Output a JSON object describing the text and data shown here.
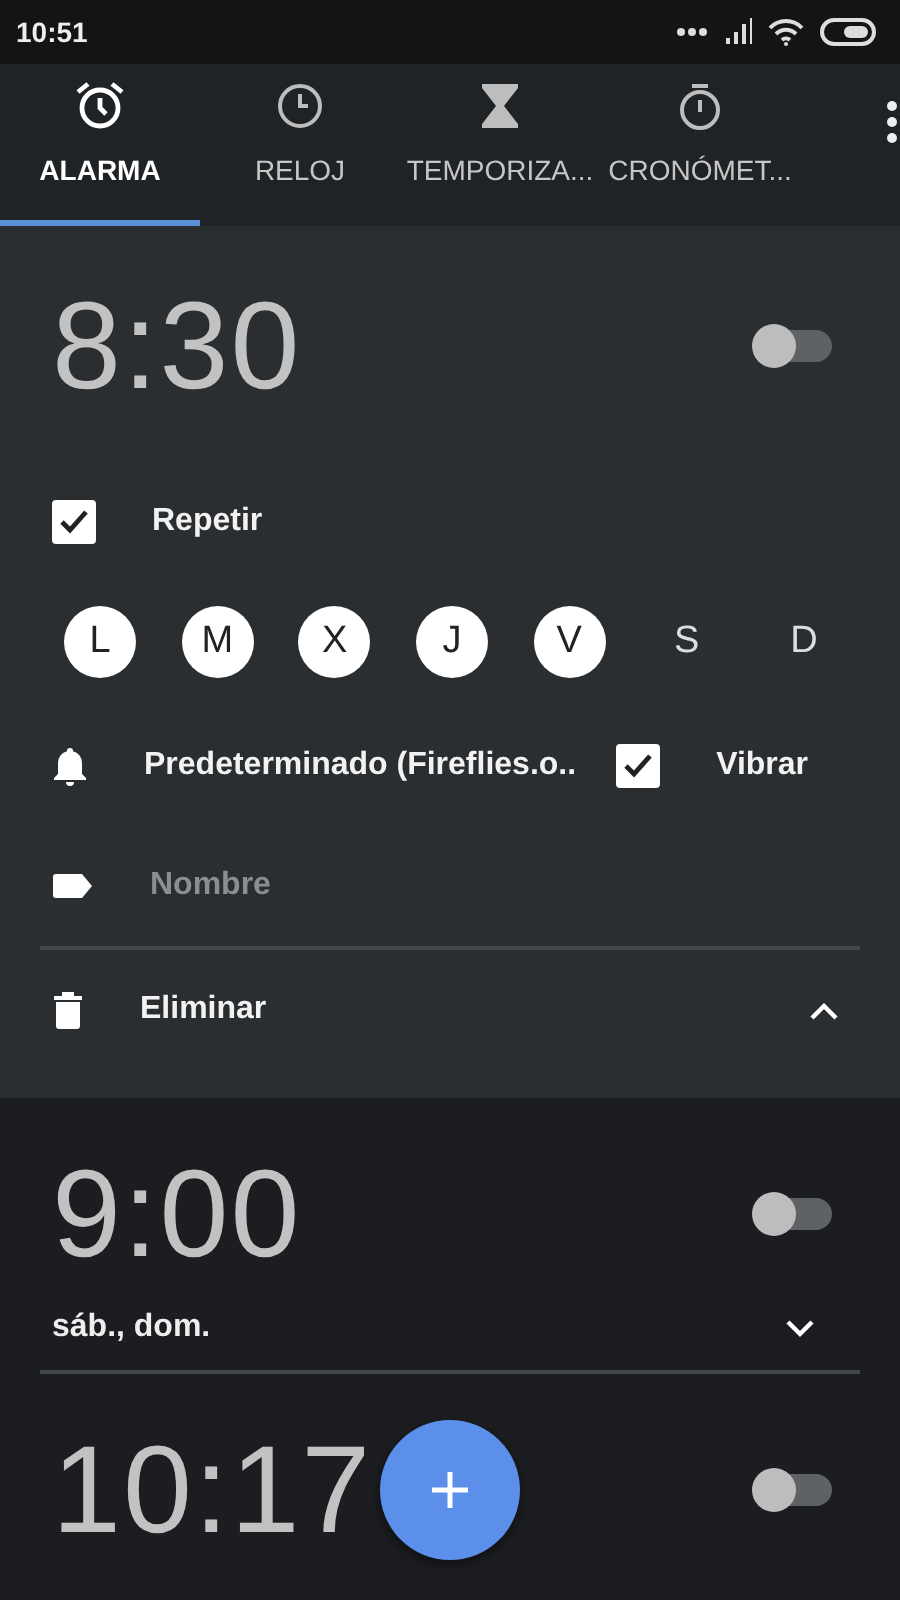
{
  "status_bar": {
    "time": "10:51"
  },
  "tabs": [
    {
      "label": "ALARMA",
      "kind": "alarm",
      "selected": true
    },
    {
      "label": "RELOJ",
      "kind": "clock",
      "selected": false
    },
    {
      "label": "TEMPORIZA...",
      "kind": "timer",
      "selected": false
    },
    {
      "label": "CRONÓMET...",
      "kind": "stopwatch",
      "selected": false
    }
  ],
  "alarms": [
    {
      "time": "8:30",
      "on": false,
      "expanded": true,
      "repeat": {
        "label": "Repetir",
        "checked": true
      },
      "days": [
        {
          "label": "L",
          "selected": true
        },
        {
          "label": "M",
          "selected": true
        },
        {
          "label": "X",
          "selected": true
        },
        {
          "label": "J",
          "selected": true
        },
        {
          "label": "V",
          "selected": true
        },
        {
          "label": "S",
          "selected": false
        },
        {
          "label": "D",
          "selected": false
        }
      ],
      "ringtone": "Predeterminado (Fireflies.o..",
      "vibrate": {
        "label": "Vibrar",
        "checked": true
      },
      "name_placeholder": "Nombre",
      "delete_label": "Eliminar"
    },
    {
      "time": "9:00",
      "on": false,
      "expanded": false,
      "summary": "sáb., dom."
    },
    {
      "time": "10:17",
      "on": false
    }
  ]
}
